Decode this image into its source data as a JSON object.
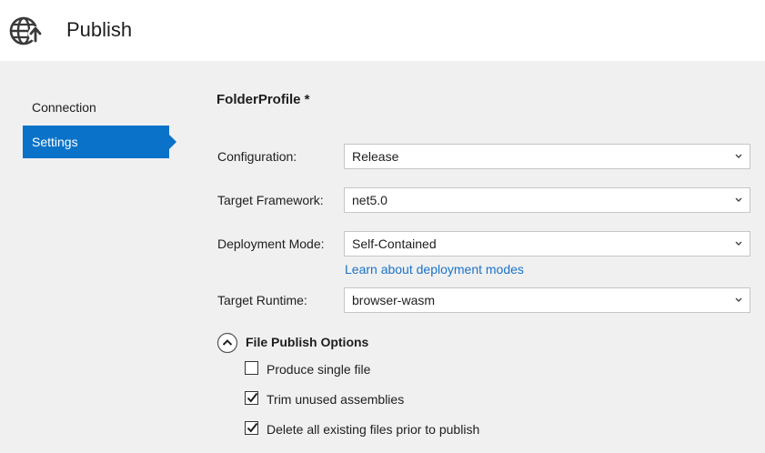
{
  "header": {
    "title": "Publish",
    "icon": "globe-publish-icon"
  },
  "sidebar": {
    "items": [
      {
        "label": "Connection",
        "selected": false
      },
      {
        "label": "Settings",
        "selected": true
      }
    ],
    "selected_color": "#0a73c9"
  },
  "main": {
    "profile_name": "FolderProfile *",
    "fields": [
      {
        "label": "Configuration:",
        "value": "Release"
      },
      {
        "label": "Target Framework:",
        "value": "net5.0"
      },
      {
        "label": "Deployment Mode:",
        "value": "Self-Contained"
      },
      {
        "label": "Target Runtime:",
        "value": "browser-wasm"
      }
    ],
    "deployment_link": "Learn about deployment modes",
    "file_publish": {
      "title": "File Publish Options",
      "expanded": true,
      "options": [
        {
          "label": "Produce single file",
          "checked": false
        },
        {
          "label": "Trim unused assemblies",
          "checked": true
        },
        {
          "label": "Delete all existing files prior to publish",
          "checked": true
        }
      ]
    }
  },
  "colors": {
    "accent": "#0a73c9",
    "link": "#1a73c9",
    "background": "#f0f0f0"
  }
}
